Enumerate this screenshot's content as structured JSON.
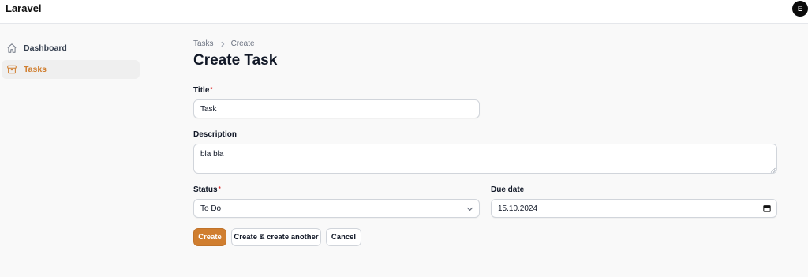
{
  "app": {
    "brand": "Laravel",
    "user_initial": "E"
  },
  "sidebar": {
    "items": [
      {
        "label": "Dashboard",
        "icon": "home-icon",
        "active": false
      },
      {
        "label": "Tasks",
        "icon": "archive-icon",
        "active": true
      }
    ]
  },
  "breadcrumb": {
    "parent": "Tasks",
    "current": "Create"
  },
  "page": {
    "title": "Create Task"
  },
  "form": {
    "title": {
      "label": "Title",
      "required_mark": "*",
      "value": "Task"
    },
    "description": {
      "label": "Description",
      "value": "bla bla"
    },
    "status": {
      "label": "Status",
      "required_mark": "*",
      "value": "To Do"
    },
    "due_date": {
      "label": "Due date",
      "value": "15.10.2024"
    }
  },
  "actions": {
    "create": "Create",
    "create_another": "Create & create another",
    "cancel": "Cancel"
  },
  "colors": {
    "accent": "#d07e2f",
    "required": "#dc2626"
  }
}
